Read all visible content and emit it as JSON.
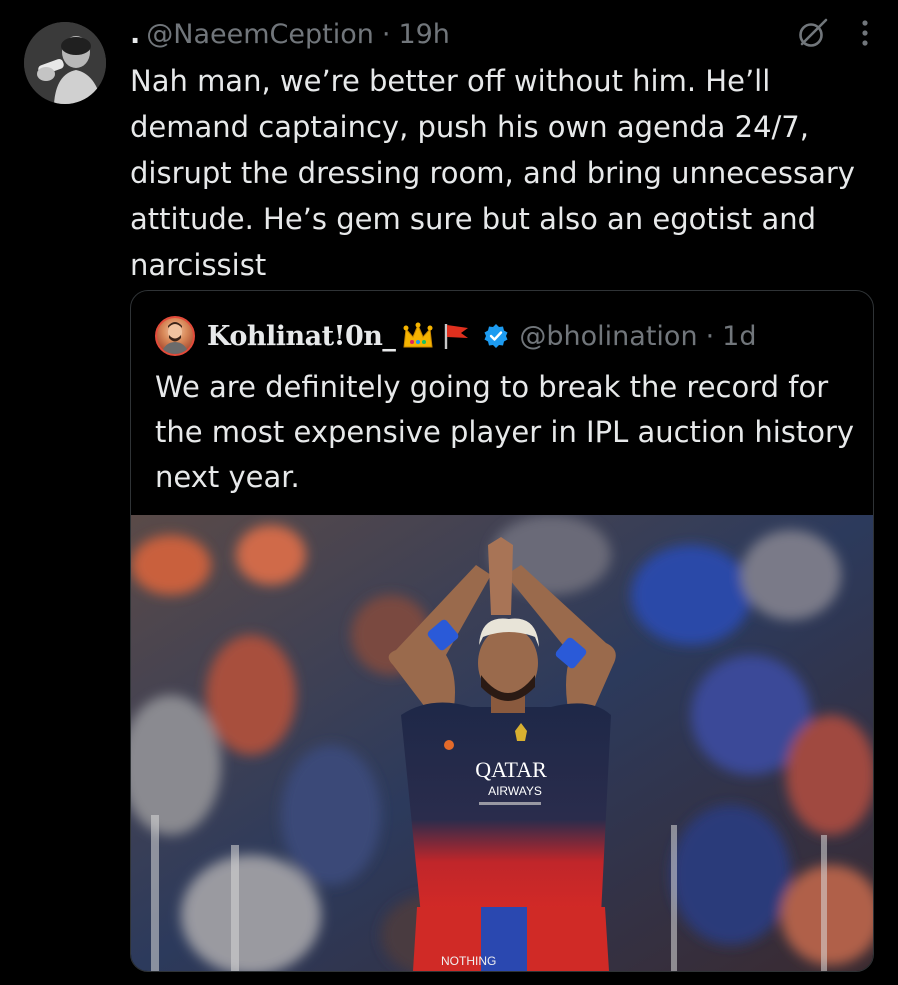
{
  "tweet": {
    "display_name": ".",
    "handle": "@NaeemCeption",
    "separator": "·",
    "time": "19h",
    "text": "Nah man, we’re better off without him. He’ll demand captaincy, push his own agenda 24/7, disrupt the dressing room, and bring unnecessary attitude. He’s gem sure but also an egotist and narcissist",
    "icons": {
      "grok": "grok-icon",
      "more": "more-options-icon"
    }
  },
  "quote": {
    "display_name": "Kohlinat!0n_",
    "emojis": [
      "crown-emoji",
      "red-flag-emoji"
    ],
    "verified": true,
    "handle": "@bholination",
    "separator": "·",
    "time": "1d",
    "text": "We are definitely going to break the record for the most expensive player in IPL auction history next year.",
    "media": {
      "jersey_text": "QATAR",
      "jersey_subtext": "AIRWAYS",
      "shorts_left": "NOTHING"
    }
  },
  "colors": {
    "background": "#000000",
    "text_primary": "#e7e9ea",
    "text_secondary": "#71767b",
    "border": "#2f3336",
    "verified_blue": "#1d9bf0"
  }
}
